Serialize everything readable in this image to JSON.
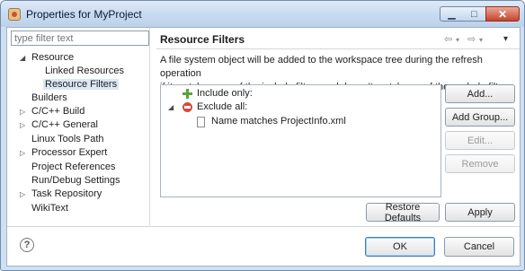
{
  "window": {
    "title": "Properties for MyProject",
    "minimize_glyph": "▁",
    "maximize_glyph": "□",
    "close_glyph": "✕"
  },
  "sidebar": {
    "filter_placeholder": "type filter text",
    "items": [
      {
        "label": "Resource",
        "twisty": "expanded"
      },
      {
        "label": "Linked Resources"
      },
      {
        "label": "Resource Filters",
        "selected": true
      },
      {
        "label": "Builders"
      },
      {
        "label": "C/C++ Build",
        "twisty": "collapsed"
      },
      {
        "label": "C/C++ General",
        "twisty": "collapsed"
      },
      {
        "label": "Linux Tools Path"
      },
      {
        "label": "Processor Expert",
        "twisty": "collapsed"
      },
      {
        "label": "Project References"
      },
      {
        "label": "Run/Debug Settings"
      },
      {
        "label": "Task Repository",
        "twisty": "collapsed"
      },
      {
        "label": "WikiText"
      }
    ]
  },
  "page": {
    "title": "Resource Filters",
    "nav": {
      "back": "⇦",
      "forward": "⇨",
      "menu": "▾"
    },
    "description_line1": "A file system object will be added to the workspace tree during the refresh operation",
    "description_line2": "if it matches any of the include filters and doesn't match any of the exclude filters.",
    "filters": {
      "include": "Include only:",
      "exclude": "Exclude all:",
      "exclude_child": "Name matches ProjectInfo.xml"
    },
    "buttons": {
      "add": "Add...",
      "add_group": "Add Group...",
      "edit": "Edit...",
      "remove": "Remove",
      "restore_defaults": "Restore Defaults",
      "apply": "Apply"
    }
  },
  "footer": {
    "help": "?",
    "ok": "OK",
    "cancel": "Cancel"
  },
  "colors": {
    "titlebar": "#c7daef",
    "selection": "#dbe7f5",
    "include_icon": "#59a43a",
    "exclude_icon": "#d64a3a"
  }
}
